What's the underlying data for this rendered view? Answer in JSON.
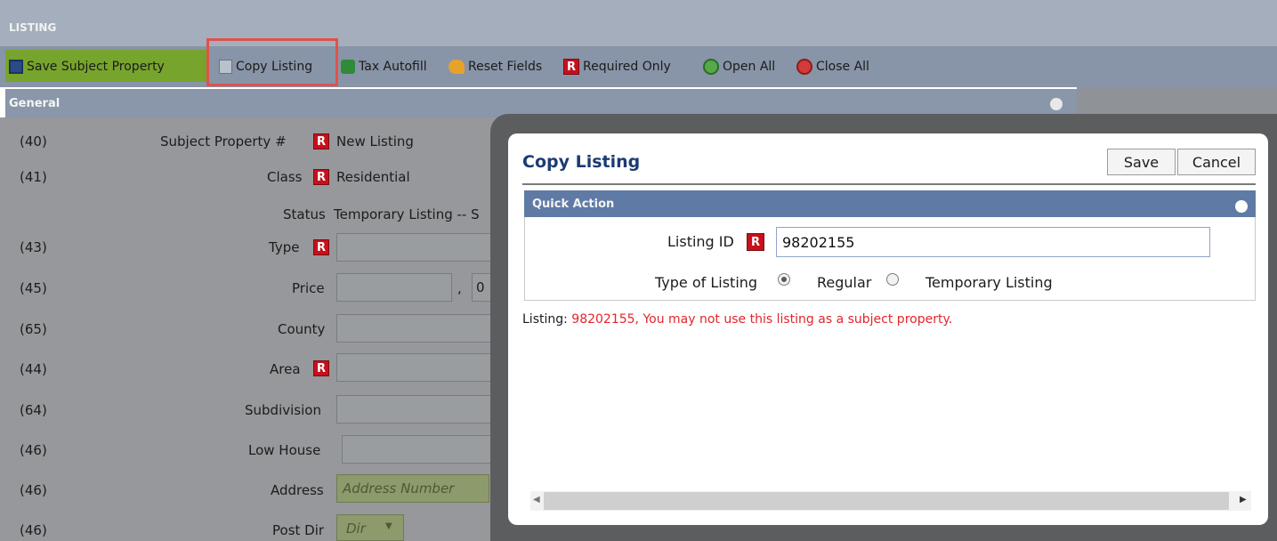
{
  "header": {
    "title": "LISTING"
  },
  "toolbar": {
    "save_subject_property": "Save Subject Property",
    "copy_listing": "Copy Listing",
    "tax_autofill": "Tax Autofill",
    "reset_fields": "Reset Fields",
    "required_only": "Required Only",
    "open_all": "Open All",
    "close_all": "Close All",
    "required_badge": "R"
  },
  "general": {
    "title": "General",
    "rows": {
      "subject_property": {
        "num": "(40)",
        "label": "Subject Property #",
        "value": "New Listing"
      },
      "class": {
        "num": "(41)",
        "label": "Class",
        "value": "Residential"
      },
      "status": {
        "label": "Status",
        "value": "Temporary Listing -- S"
      },
      "type": {
        "num": "(43)",
        "label": "Type"
      },
      "price": {
        "num": "(45)",
        "label": "Price",
        "sep": ",",
        "cents": "0"
      },
      "county": {
        "num": "(65)",
        "label": "County"
      },
      "area": {
        "num": "(44)",
        "label": "Area"
      },
      "subdivision": {
        "num": "(64)",
        "label": "Subdivision"
      },
      "low_house": {
        "num": "(46)",
        "label": "Low House"
      },
      "address": {
        "num": "(46)",
        "label": "Address",
        "placeholder": "Address Number"
      },
      "post_dir": {
        "num": "(46)",
        "label": "Post Dir",
        "placeholder": "Dir",
        "arrow": "▼"
      }
    }
  },
  "modal": {
    "title": "Copy Listing",
    "save": "Save",
    "cancel": "Cancel",
    "quick_action": "Quick Action",
    "listing_id_label": "Listing ID",
    "listing_id_value": "98202155",
    "type_label": "Type of Listing",
    "option_regular": "Regular",
    "option_temporary": "Temporary Listing",
    "selected_option": "Regular",
    "message_prefix": "Listing:",
    "message_text": "98202155, You may not use this listing as a subject property."
  },
  "colors": {
    "error": "#e2262c",
    "required": "#c7101c",
    "modal_title": "#1c3c72",
    "toolbar_green": "#77a42c"
  },
  "icons": [
    "floppy-disk-icon",
    "copy-icon",
    "tax-autofill-icon",
    "reset-icon",
    "required-icon",
    "open-all-icon",
    "close-all-icon",
    "collapse-icon",
    "dropdown-arrow-icon",
    "scroll-left-icon",
    "scroll-right-icon"
  ]
}
